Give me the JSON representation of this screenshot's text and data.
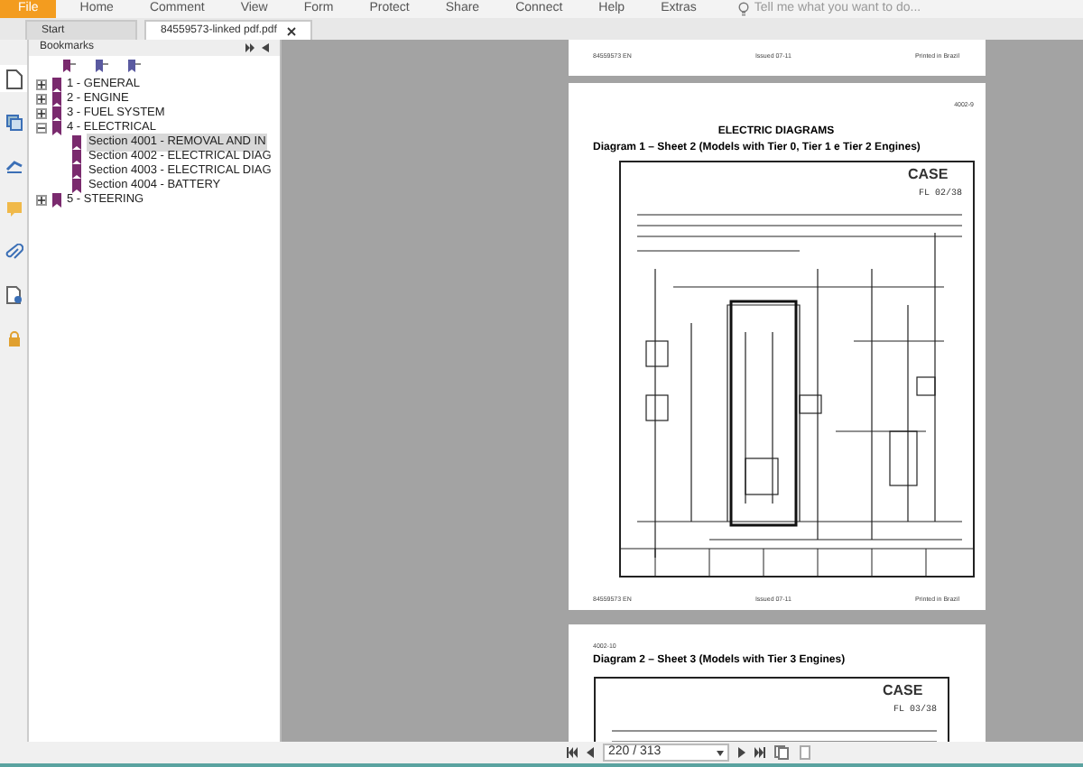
{
  "menu": [
    {
      "label": "File",
      "selected": true
    },
    {
      "label": "Home",
      "selected": false
    },
    {
      "label": "Comment",
      "selected": false
    },
    {
      "label": "View",
      "selected": false
    },
    {
      "label": "Form",
      "selected": false
    },
    {
      "label": "Protect",
      "selected": false
    },
    {
      "label": "Share",
      "selected": false
    },
    {
      "label": "Connect",
      "selected": false
    },
    {
      "label": "Help",
      "selected": false
    },
    {
      "label": "Extras",
      "selected": false
    }
  ],
  "search": {
    "placeholder": "Tell me what you want to do..."
  },
  "tabs": [
    {
      "label": "Start",
      "selected": false,
      "closable": false
    },
    {
      "label": "84559573-linked pdf.pdf",
      "selected": true,
      "closable": true
    }
  ],
  "side_strip": [
    {
      "kind": "page",
      "selected": true
    },
    {
      "kind": "layers",
      "selected": false
    },
    {
      "kind": "signature",
      "selected": false
    },
    {
      "kind": "comment",
      "selected": false
    },
    {
      "kind": "attachment",
      "selected": false
    },
    {
      "kind": "properties",
      "selected": false
    },
    {
      "kind": "security",
      "selected": false
    }
  ],
  "bookmarks": {
    "title": "Bookmarks",
    "items": [
      {
        "label": "1 - GENERAL",
        "expanded": false,
        "selected": false
      },
      {
        "label": "2 - ENGINE",
        "expanded": false,
        "selected": false
      },
      {
        "label": "3 - FUEL SYSTEM",
        "expanded": false,
        "selected": false
      },
      {
        "label": "4 - ELECTRICAL",
        "expanded": true,
        "selected": false,
        "children": [
          {
            "label": "Section 4001 - REMOVAL AND IN",
            "selected": true
          },
          {
            "label": "Section 4002 - ELECTRICAL DIAG",
            "selected": false
          },
          {
            "label": "Section 4003 - ELECTRICAL DIAG",
            "selected": false
          },
          {
            "label": "Section 4004 - BATTERY",
            "selected": false
          }
        ]
      },
      {
        "label": "5 - STEERING",
        "expanded": false,
        "selected": false
      }
    ]
  },
  "pages": [
    {
      "footer": [
        "84559573 EN",
        "Issued 07-11",
        "Printed in Brazil"
      ]
    },
    {
      "number": "4002-9",
      "heading": "ELECTRIC DIAGRAMS",
      "title": "Diagram 1 – Sheet 2 (Models with Tier 0, Tier 1 e Tier 2 Engines)",
      "logo": "CASE",
      "sheet": "FL 02/38",
      "footer": [
        "84559573 EN",
        "Issued 07-11",
        "Printed in Brazil"
      ]
    },
    {
      "number": "4002-10",
      "title": "Diagram 2 – Sheet 3 (Models with Tier 3 Engines)",
      "logo": "CASE",
      "sheet": "FL 03/38"
    }
  ],
  "pager": {
    "value": "220 / 313"
  }
}
